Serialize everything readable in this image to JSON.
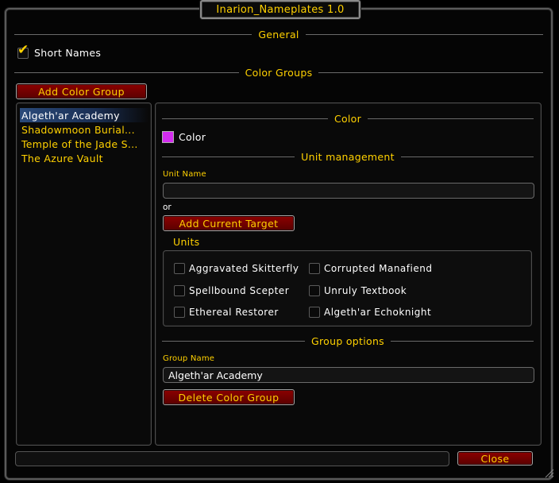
{
  "window": {
    "title": "Inarion_Nameplates 1.0"
  },
  "general": {
    "heading": "General",
    "short_names": {
      "label": "Short Names",
      "checked": true
    }
  },
  "color_groups": {
    "heading": "Color Groups",
    "add_button": "Add Color Group",
    "list": [
      {
        "label": "Algeth'ar Academy",
        "selected": true
      },
      {
        "label": "Shadowmoon Burial...",
        "selected": false
      },
      {
        "label": "Temple of the Jade S...",
        "selected": false
      },
      {
        "label": "The Azure Vault",
        "selected": false
      }
    ]
  },
  "detail": {
    "color_heading": "Color",
    "color_label": "Color",
    "color_value": "#d42cf0",
    "unit_heading": "Unit management",
    "unit_name_label": "Unit Name",
    "unit_name_value": "",
    "or_label": "or",
    "add_target_button": "Add Current Target",
    "units_label": "Units",
    "units": [
      {
        "label": "Aggravated Skitterfly",
        "checked": false
      },
      {
        "label": "Corrupted Manafiend",
        "checked": false
      },
      {
        "label": "Spellbound Scepter",
        "checked": false
      },
      {
        "label": "Unruly Textbook",
        "checked": false
      },
      {
        "label": "Ethereal Restorer",
        "checked": false
      },
      {
        "label": "Algeth'ar Echoknight",
        "checked": false
      }
    ],
    "group_options_heading": "Group options",
    "group_name_label": "Group Name",
    "group_name_value": "Algeth'ar Academy",
    "delete_button": "Delete Color Group"
  },
  "footer": {
    "status_text": "",
    "close_button": "Close"
  },
  "colors": {
    "gold": "#ffd100",
    "button_red": "#8c0000",
    "selection_blue": "#2a4a7a"
  }
}
